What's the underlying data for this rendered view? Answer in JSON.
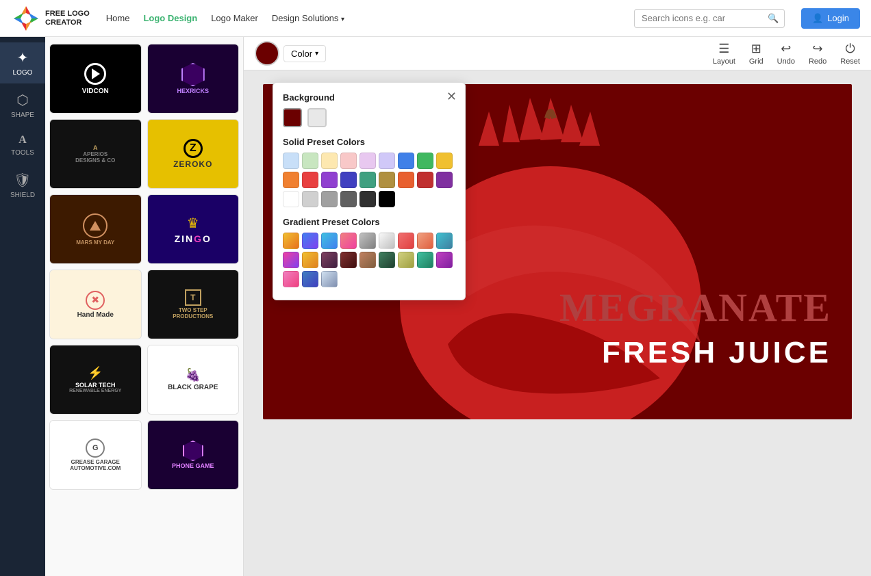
{
  "topnav": {
    "logo_text_free": "FREE LOGO",
    "logo_text_creator": "CREATOR",
    "nav_home": "Home",
    "nav_logo_design": "Logo Design",
    "nav_logo_maker": "Logo Maker",
    "nav_design_solutions": "Design Solutions",
    "search_placeholder": "Search icons e.g. car",
    "login_label": "Login"
  },
  "sidebar": {
    "items": [
      {
        "label": "LOGO",
        "icon": "✦"
      },
      {
        "label": "SHAPE",
        "icon": "⬡"
      },
      {
        "label": "TOOLS",
        "icon": "A"
      },
      {
        "label": "SHIELD",
        "icon": "🛡"
      }
    ]
  },
  "toolbar": {
    "color_label": "Color",
    "layout_label": "Layout",
    "grid_label": "Grid",
    "undo_label": "Undo",
    "redo_label": "Redo",
    "reset_label": "Reset"
  },
  "color_popup": {
    "title_background": "Background",
    "title_solid": "Solid Preset Colors",
    "title_gradient": "Gradient Preset Colors",
    "solid_colors": [
      "#c8dff8",
      "#c8e6c0",
      "#fde8b0",
      "#f8c8c8",
      "#e8c8f0",
      "#d0c8f8",
      "#4080e8",
      "#40b860",
      "#f0c030",
      "#f08030",
      "#e84040",
      "#9040d0",
      "#4040c0",
      "#40a080",
      "#b09040",
      "#e86030",
      "#c03030",
      "#8030a0",
      "#ffffff",
      "#d0d0d0",
      "#a0a0a0",
      "#606060",
      "#303030",
      "#000000"
    ],
    "gradient_colors": [
      {
        "from": "#f0c030",
        "to": "#e87020"
      },
      {
        "from": "#4080f0",
        "to": "#8040f0"
      },
      {
        "from": "#40c0e0",
        "to": "#4080f0"
      },
      {
        "from": "#f08080",
        "to": "#f040a0"
      },
      {
        "from": "#c0c0c0",
        "to": "#808080"
      },
      {
        "from": "#f8f8f8",
        "to": "#c0c0c0"
      },
      {
        "from": "#f07070",
        "to": "#e04040"
      },
      {
        "from": "#f0a080",
        "to": "#e06040"
      },
      {
        "from": "#40c0d0",
        "to": "#4080a0"
      },
      {
        "from": "#f040a0",
        "to": "#8040f0"
      },
      {
        "from": "#f0c030",
        "to": "#e08020"
      },
      {
        "from": "#804060",
        "to": "#402040"
      },
      {
        "from": "#803030",
        "to": "#401010"
      },
      {
        "from": "#c08060",
        "to": "#806040"
      },
      {
        "from": "#408060",
        "to": "#204030"
      },
      {
        "from": "#d0d080",
        "to": "#a0a040"
      },
      {
        "from": "#40c0a0",
        "to": "#208060"
      },
      {
        "from": "#c040c0",
        "to": "#8020a0"
      },
      {
        "from": "#f080c0",
        "to": "#f04080"
      },
      {
        "from": "#4080c0",
        "to": "#4040c0"
      },
      {
        "from": "#d0e0f0",
        "to": "#8090b0"
      }
    ]
  },
  "canvas": {
    "title_line1": "MEGRANATE",
    "title_line2": "FRESH JUICE"
  },
  "templates": [
    {
      "id": "vidcon",
      "name": "VIDCON",
      "bg": "#000000"
    },
    {
      "id": "hexricks",
      "name": "HEXRICKS",
      "bg": "#1a0033"
    },
    {
      "id": "aperios",
      "name": "APERIOS DESIGNS & CO",
      "bg": "#111111"
    },
    {
      "id": "zeroko",
      "name": "ZEROKO",
      "bg": "#e6c000"
    },
    {
      "id": "mars",
      "name": "MARS MY DAY",
      "bg": "#3d1a00"
    },
    {
      "id": "zingo",
      "name": "ZIN GO",
      "bg": "#1a0066"
    },
    {
      "id": "handmade",
      "name": "Hand Made",
      "bg": "#fdf3dc"
    },
    {
      "id": "twostep",
      "name": "TWO STEP PRODUCTIONS",
      "bg": "#111111"
    },
    {
      "id": "solartech",
      "name": "SOLAR TECH",
      "bg": "#111111"
    },
    {
      "id": "blackgrape",
      "name": "BLACK GRAPE",
      "bg": "#ffffff"
    },
    {
      "id": "grease",
      "name": "GREASE GARAGE AUTOMOTIVE.COM",
      "bg": "#ffffff"
    },
    {
      "id": "phonegame",
      "name": "PHONE GAME",
      "bg": "#1a0033"
    }
  ]
}
